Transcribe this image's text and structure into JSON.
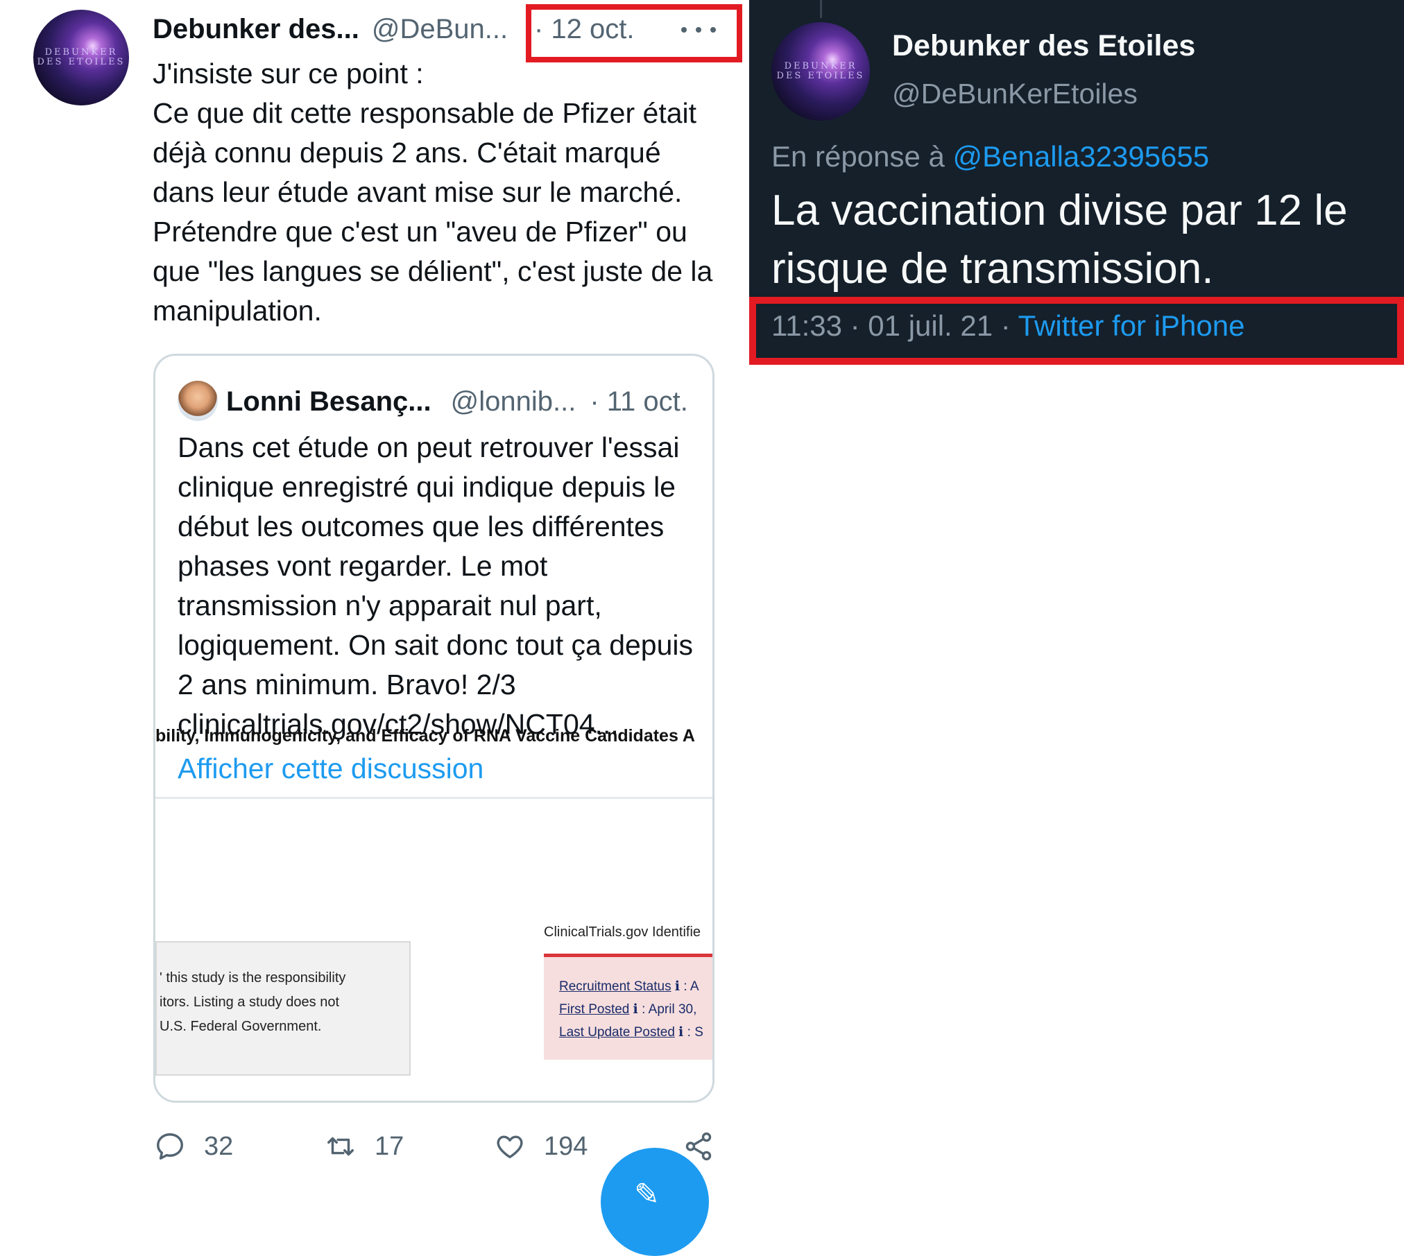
{
  "left_tweet": {
    "author_name": "Debunker des...",
    "author_handle": "@DeBun...",
    "date": "· 12 oct.",
    "body": "J'insiste sur ce point :\nCe que dit cette responsable de Pfizer était déjà connu depuis 2 ans. C'était marqué dans leur étude avant mise sur le marché.\nPrétendre que c'est un \"aveu de Pfizer\" ou que \"les langues se délient\", c'est juste de la manipulation.",
    "quoted": {
      "author_name": "Lonni Besanç...",
      "author_handle": "@lonnib...",
      "date": "· 11 oct.",
      "text": "Dans cet étude on peut retrouver l'essai clinique enregistré qui indique depuis le début les outcomes que les différentes phases vont regarder. Le mot transmission n'y apparait nul part, logiquement. On sait donc tout ça depuis 2 ans minimum. Bravo! 2/3\nclinicaltrials.gov/ct2/show/NCT04...",
      "show_thread": "Afficher cette discussion",
      "image": {
        "doc_title": "bility, Immunogenicity, and Efficacy of RNA Vaccine Candidates A",
        "notice_text": "' this study is the responsibility\nitors. Listing a study does not\n U.S. Federal Government.",
        "ct_identifier": "ClinicalTrials.gov Identifie",
        "recruitment_status": "Recruitment Status",
        "recruitment_value": ": A",
        "first_posted": "First Posted",
        "first_posted_value": ": April 30,",
        "last_update": "Last Update Posted",
        "last_update_value": ": S"
      }
    },
    "actions": {
      "replies": "32",
      "retweets": "17",
      "likes": "194"
    }
  },
  "right_tweet": {
    "author_name": "Debunker des Etoiles",
    "author_handle": "@DeBunKerEtoiles",
    "reply_prefix": "En réponse à ",
    "reply_mention": "@Benalla32395655",
    "text": "La vaccination divise par 12 le risque de transmission.",
    "time_date": "11:33 · 01 juil. 21 · ",
    "source": "Twitter for iPhone"
  },
  "avatar_logo_text": "DEBUNKER\nDES ETOILES",
  "colors": {
    "accent": "#1d9bf0",
    "highlight_box": "#e21b23",
    "dark_bg": "#15202b",
    "muted": "#536471"
  }
}
